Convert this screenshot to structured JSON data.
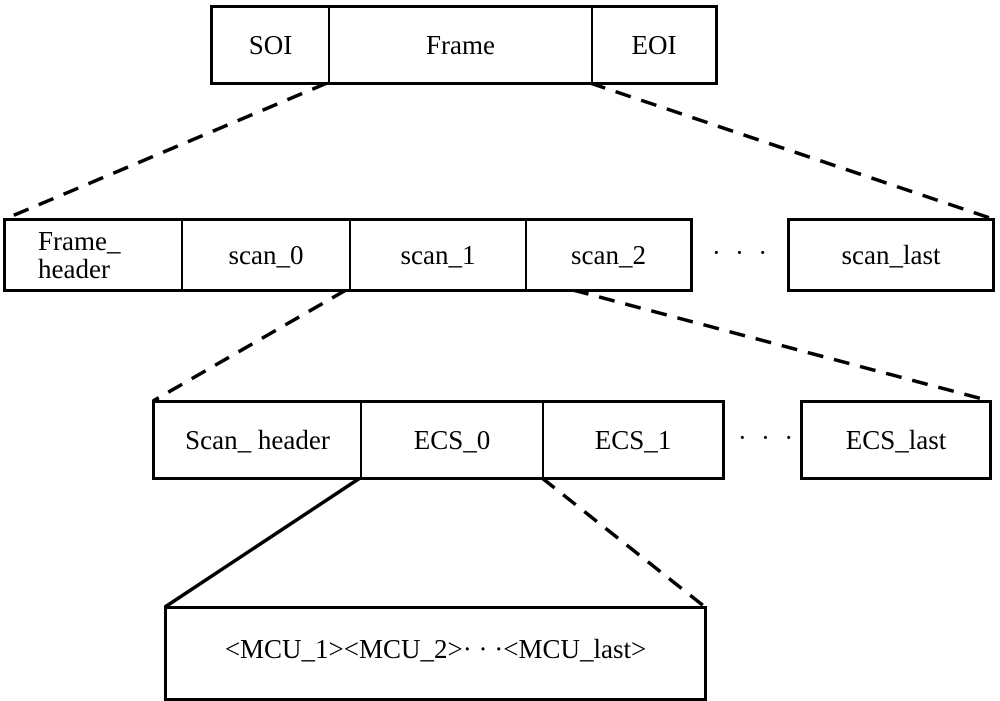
{
  "diagram": {
    "title_hidden": "",
    "level1": {
      "segments": [
        "SOI",
        "Frame",
        "EOI"
      ]
    },
    "level2": {
      "segments": [
        "Frame_\nheader",
        "scan_0",
        "scan_1",
        "scan_2"
      ],
      "ellipsis": "· · ·",
      "last": "scan_last"
    },
    "level3": {
      "segments": [
        "Scan_ header",
        "ECS_0",
        "ECS_1"
      ],
      "ellipsis": "· · ·",
      "last": "ECS_last"
    },
    "level4": {
      "content": "<MCU_1><MCU_2>· · ·<MCU_last>"
    },
    "connectors": [
      {
        "from": "Frame",
        "to": "level2",
        "style": "dashed"
      },
      {
        "from": "scan_1",
        "to": "level3",
        "style": "dashed"
      },
      {
        "from": "ECS_0",
        "to": "level4",
        "style": "solid-left/dashed-right"
      }
    ]
  }
}
